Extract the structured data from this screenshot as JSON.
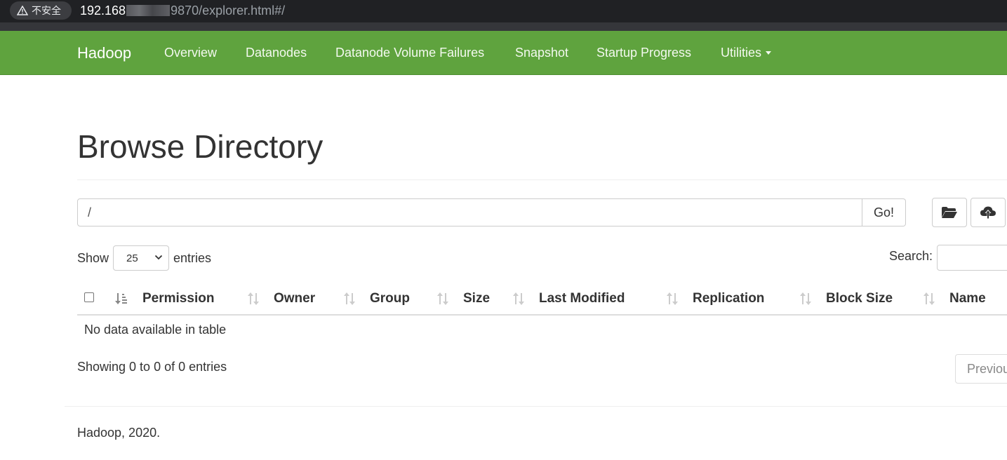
{
  "browser": {
    "security_label": "不安全",
    "url_host": "192.168",
    "url_rest": "9870/explorer.html#/"
  },
  "navbar": {
    "brand": "Hadoop",
    "items": [
      {
        "label": "Overview"
      },
      {
        "label": "Datanodes"
      },
      {
        "label": "Datanode Volume Failures"
      },
      {
        "label": "Snapshot"
      },
      {
        "label": "Startup Progress"
      },
      {
        "label": "Utilities"
      }
    ]
  },
  "page": {
    "title": "Browse Directory",
    "path_value": "/",
    "go_label": "Go!",
    "icons": [
      "folder-open-icon",
      "cloud-upload-icon"
    ]
  },
  "controls": {
    "show_label": "Show",
    "page_size": "25",
    "entries_label": "entries",
    "search_label": "Search:"
  },
  "table": {
    "columns": [
      "Permission",
      "Owner",
      "Group",
      "Size",
      "Last Modified",
      "Replication",
      "Block Size",
      "Name"
    ],
    "empty_message": "No data available in table",
    "info": "Showing 0 to 0 of 0 entries",
    "prev_label": "Previous"
  },
  "footer": {
    "text": "Hadoop, 2020."
  },
  "colors": {
    "navbar": "#5fa33e",
    "browser_bar": "#202124"
  }
}
